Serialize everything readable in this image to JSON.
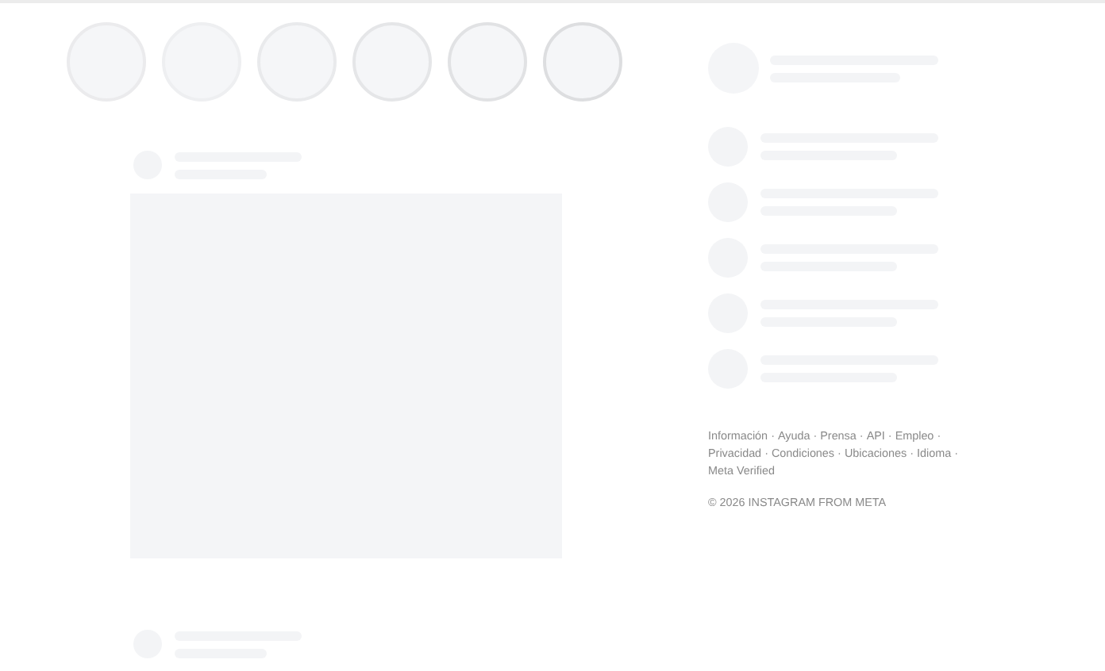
{
  "footer": {
    "separator": "·",
    "lines": [
      [
        "Información",
        "Ayuda",
        "Prensa",
        "API",
        "Empleo"
      ],
      [
        "Privacidad",
        "Condiciones",
        "Ubicaciones",
        "Idioma"
      ],
      [
        "Meta Verified"
      ]
    ],
    "copyright": "© 2026 INSTAGRAM FROM META"
  }
}
